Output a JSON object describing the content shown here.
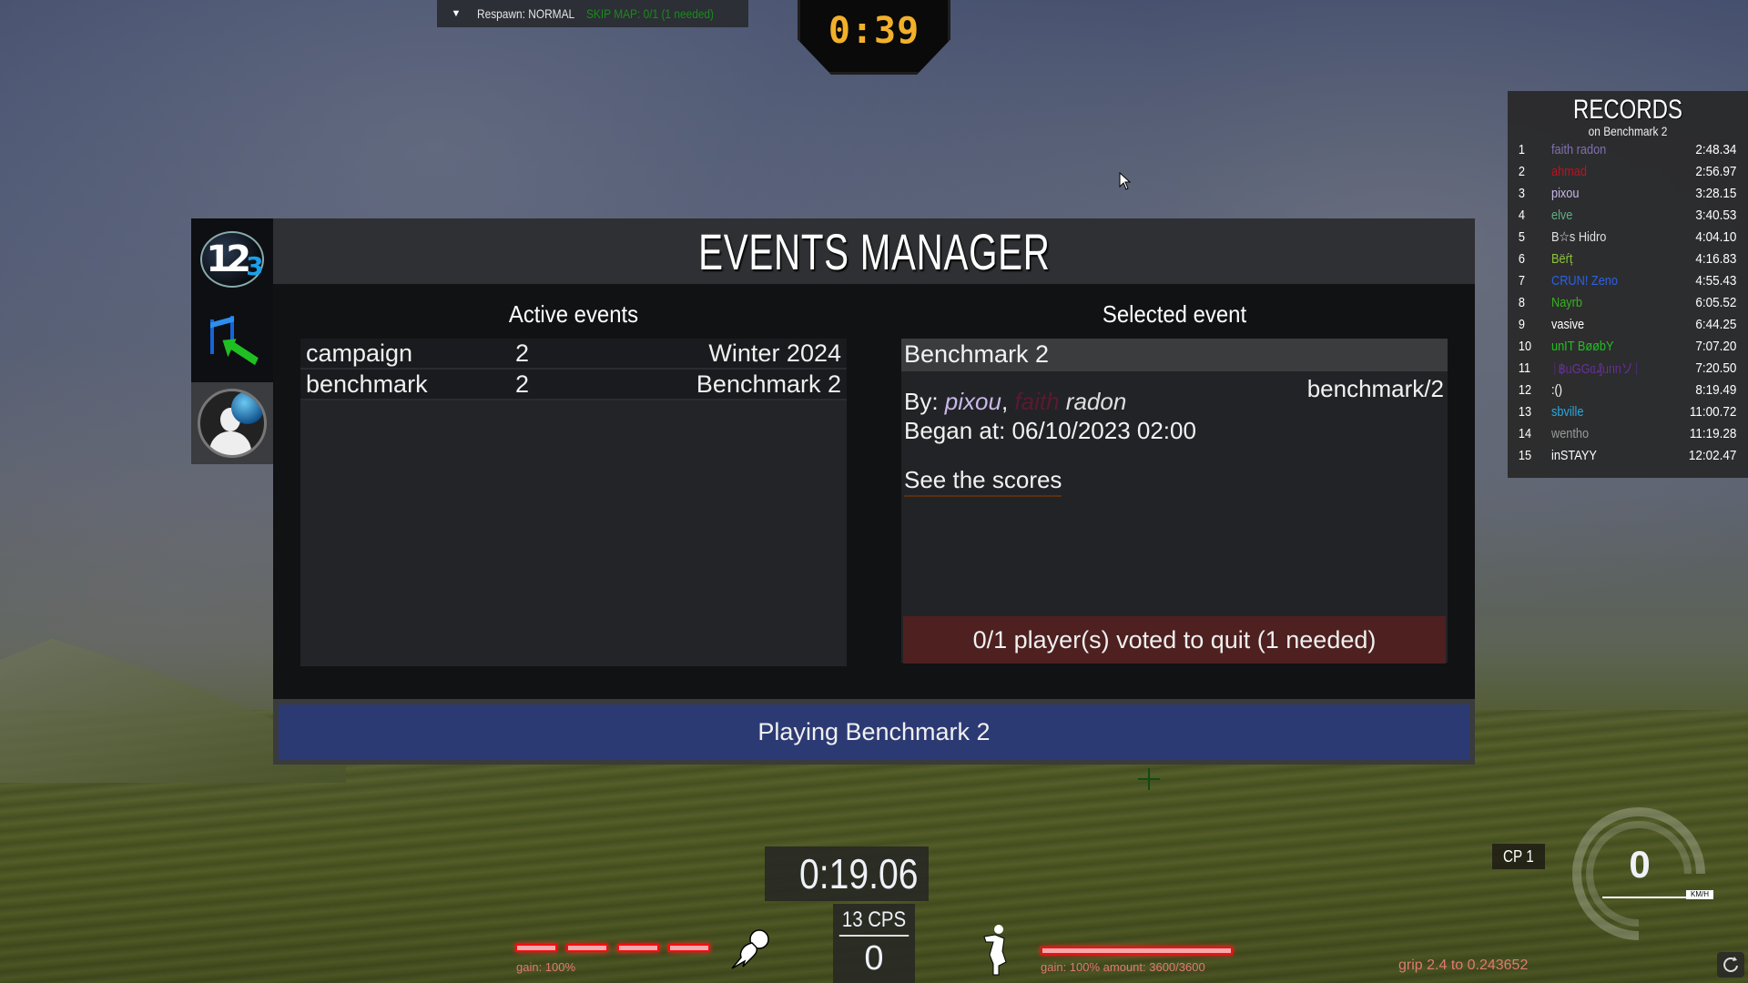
{
  "topbar": {
    "respawn": "Respawn: NORMAL",
    "skip_map": "SKIP MAP: 0/1 (1 needed)",
    "skip_color": "#1a8a1a"
  },
  "countdown": {
    "value": "0:39",
    "color": "#f2b02a"
  },
  "records": {
    "title": "RECORDS",
    "subtitle": "on Benchmark 2",
    "rows": [
      {
        "rank": "1",
        "name": "faith radon",
        "time": "2:48.34",
        "color": "#8070b0"
      },
      {
        "rank": "2",
        "name": "ahmad",
        "time": "2:56.97",
        "color": "#c01020"
      },
      {
        "rank": "3",
        "name": "pixou",
        "time": "3:28.15",
        "color": "#c8b8e8"
      },
      {
        "rank": "4",
        "name": "elve",
        "time": "3:40.53",
        "color": "#5fb080"
      },
      {
        "rank": "5",
        "name": "B☆s Hidro",
        "time": "4:04.10",
        "color": "#e0e0e0"
      },
      {
        "rank": "6",
        "name": "Bëŕț",
        "time": "4:16.83",
        "color": "#8cc43a"
      },
      {
        "rank": "7",
        "name": "CRUN! Zeno",
        "time": "4:55.43",
        "color": "#2f60e0"
      },
      {
        "rank": "8",
        "name": "Nayrb",
        "time": "6:05.52",
        "color": "#38b020"
      },
      {
        "rank": "9",
        "name": "vasive",
        "time": "6:44.25",
        "color": "#ffffff"
      },
      {
        "rank": "10",
        "name": "unIT BøøbY",
        "time": "7:07.20",
        "color": "#20c020"
      },
      {
        "rank": "11",
        "name": "ᛁ฿ᥙGGᥲ₰ᥙᥒᥒソᛁ",
        "time": "7:20.50",
        "color": "#6a30a0"
      },
      {
        "rank": "12",
        "name": ":()",
        "time": "8:19.49",
        "color": "#ffffff"
      },
      {
        "rank": "13",
        "name": "sbville",
        "time": "11:00.72",
        "color": "#2aa8e0"
      },
      {
        "rank": "14",
        "name": "wentho",
        "time": "11:19.28",
        "color": "#9a9a9a"
      },
      {
        "rank": "15",
        "name": "inSTAYY",
        "time": "12:02.47",
        "color": "#ffffff"
      }
    ]
  },
  "sidebar": {
    "items": [
      {
        "icon": "ranking-123-icon",
        "label": "Rankings"
      },
      {
        "icon": "flag-arrow-icon",
        "label": "Maps"
      },
      {
        "icon": "profile-globe-icon",
        "label": "Profile"
      }
    ]
  },
  "events_manager": {
    "title": "EVENTS MANAGER",
    "active_title": "Active events",
    "selected_title": "Selected event",
    "active_events": [
      {
        "name": "campaign",
        "count": "2",
        "label": "Winter 2024"
      },
      {
        "name": "benchmark",
        "count": "2",
        "label": "Benchmark 2"
      }
    ],
    "selected": {
      "name": "Benchmark 2",
      "path": "benchmark/2",
      "by_label": "By: ",
      "author1": "pixou",
      "author2_tag": "faith",
      "author2_name": "radon",
      "began": "Began at: 06/10/2023 02:00",
      "scores_link": "See the scores"
    },
    "vote_quit": "0/1 player(s) voted to quit (1 needed)",
    "playing": "Playing Benchmark 2",
    "vote_color": "#4e2020",
    "playing_color": "#2c3a74"
  },
  "hud": {
    "race_time": "0:19.06",
    "cps": "13 CPS",
    "cp_count": "0",
    "gain_left": "gain: 100%",
    "gain_right": "gain: 100% amount: 3600/3600",
    "stamina_fraction": 1.0,
    "checkpoint": "CP 1",
    "speed": "0",
    "speed_unit": "KM/H",
    "grip": "grip 2.4 to 0.243652"
  }
}
